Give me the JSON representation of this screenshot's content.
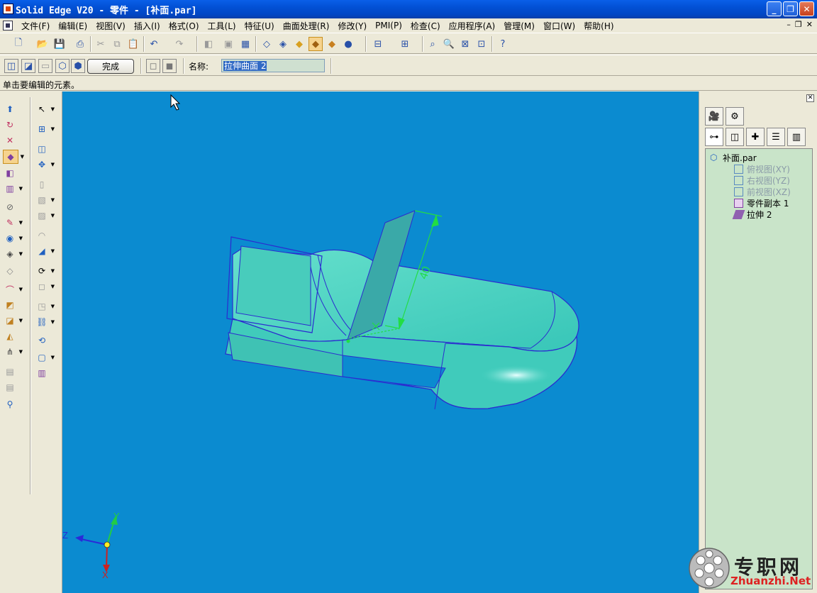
{
  "window": {
    "title": "Solid Edge V20 - 零件 - [补面.par]"
  },
  "menu": [
    "文件(F)",
    "编辑(E)",
    "视图(V)",
    "插入(I)",
    "格式(O)",
    "工具(L)",
    "特征(U)",
    "曲面处理(R)",
    "修改(Y)",
    "PMI(P)",
    "检查(C)",
    "应用程序(A)",
    "管理(M)",
    "窗口(W)",
    "帮助(H)"
  ],
  "feature_bar": {
    "finish_label": "完成",
    "name_label": "名称:",
    "name_value": "拉伸曲面 2"
  },
  "status": {
    "prompt": "单击要编辑的元素。"
  },
  "viewport": {
    "dimension_value": "40",
    "triad": {
      "x": "X",
      "y": "Y",
      "z": "Z"
    }
  },
  "tree": {
    "root": "补面.par",
    "items": [
      {
        "label": "俯视图(XY)",
        "dim": true
      },
      {
        "label": "右视图(YZ)",
        "dim": true
      },
      {
        "label": "前视图(XZ)",
        "dim": true
      },
      {
        "label": "零件副本 1",
        "dim": false
      },
      {
        "label": "拉伸 2",
        "dim": false
      }
    ]
  },
  "watermark": {
    "text": "专职网",
    "url": "Zhuanzhi.Net"
  },
  "colors": {
    "viewport_bg": "#0b8bd0",
    "surface": "#4fd4c4",
    "edge": "#2b2bd0",
    "dimension": "#22dd44"
  }
}
